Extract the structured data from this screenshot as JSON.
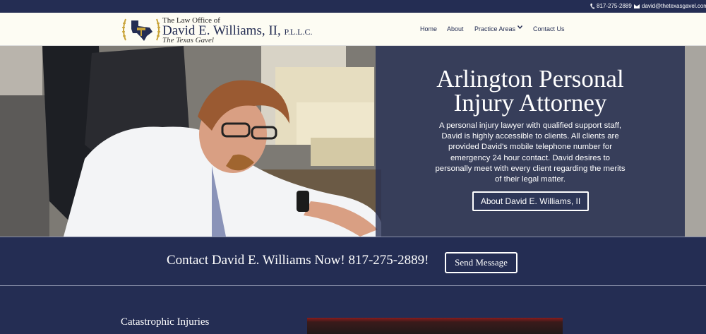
{
  "topbar": {
    "phone": "817-275-2889",
    "email": "david@thetexasgavel.com"
  },
  "logo": {
    "line1": "The Law Office of",
    "line2": "David E. Williams, II,",
    "line2_suffix": "P.L.L.C.",
    "line3": "The Texas Gavel"
  },
  "nav": {
    "items": [
      "Home",
      "About",
      "Practice Areas",
      "Contact Us"
    ]
  },
  "hero": {
    "title_line1": "Arlington Personal",
    "title_line2": "Injury Attorney",
    "paragraph": "A personal injury lawyer with qualified support staff, David is highly accessible to clients. All clients are provided David's mobile telephone number for emergency 24 hour contact. David desires to personally meet with every client regarding the merits of their legal matter.",
    "button": "About David E. Williams, II"
  },
  "contact": {
    "text": "Contact David E. Williams Now!  817-275-2889!",
    "button": "Send Message"
  },
  "lower": {
    "heading": "Catastrophic Injuries"
  },
  "colors": {
    "navy": "#242d53",
    "cream": "#fdfcf3",
    "gold": "#c9a43a"
  }
}
